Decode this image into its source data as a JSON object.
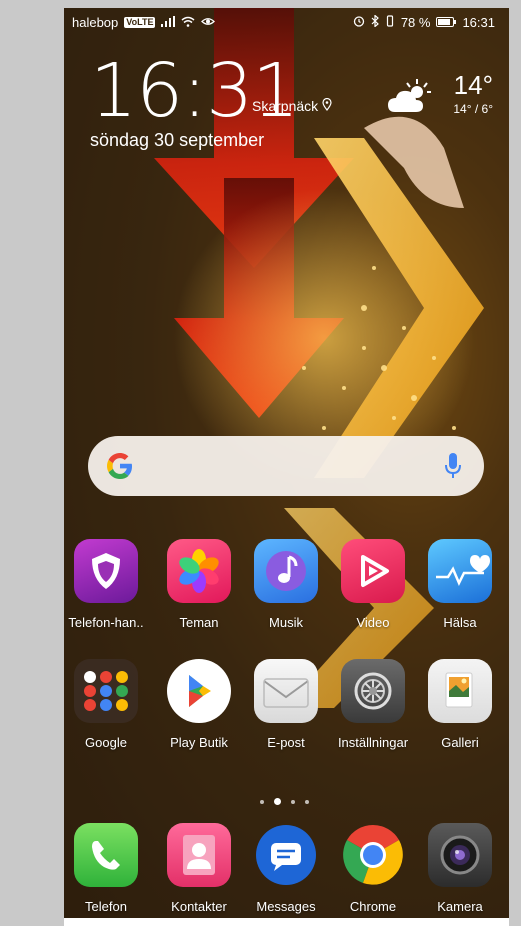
{
  "status_bar": {
    "carrier": "halebop",
    "volte": "VoLTE",
    "battery_text": "78 %",
    "time": "16:31"
  },
  "lockscreen": {
    "clock": "16:31",
    "location": "Skarpnäck",
    "date": "söndag 30 september",
    "weather": {
      "temp": "14°",
      "range": "14° / 6°",
      "icon": "partly-sunny-icon"
    }
  },
  "search": {
    "mic_icon": "mic-icon"
  },
  "apps_row1": [
    {
      "label": "Telefon-han..",
      "icon": "shield-icon"
    },
    {
      "label": "Teman",
      "icon": "themes-icon"
    },
    {
      "label": "Musik",
      "icon": "music-icon"
    },
    {
      "label": "Video",
      "icon": "video-icon"
    },
    {
      "label": "Hälsa",
      "icon": "health-icon"
    }
  ],
  "apps_row2": [
    {
      "label": "Google",
      "icon": "google-folder-icon"
    },
    {
      "label": "Play Butik",
      "icon": "play-store-icon"
    },
    {
      "label": "E-post",
      "icon": "email-icon"
    },
    {
      "label": "Inställningar",
      "icon": "settings-icon"
    },
    {
      "label": "Galleri",
      "icon": "gallery-icon"
    }
  ],
  "dock": [
    {
      "label": "Telefon",
      "icon": "phone-icon"
    },
    {
      "label": "Kontakter",
      "icon": "contacts-icon"
    },
    {
      "label": "Messages",
      "icon": "messages-icon"
    },
    {
      "label": "Chrome",
      "icon": "chrome-icon"
    },
    {
      "label": "Kamera",
      "icon": "camera-icon"
    }
  ],
  "page_indicator": {
    "pages": 3,
    "current": 2
  }
}
